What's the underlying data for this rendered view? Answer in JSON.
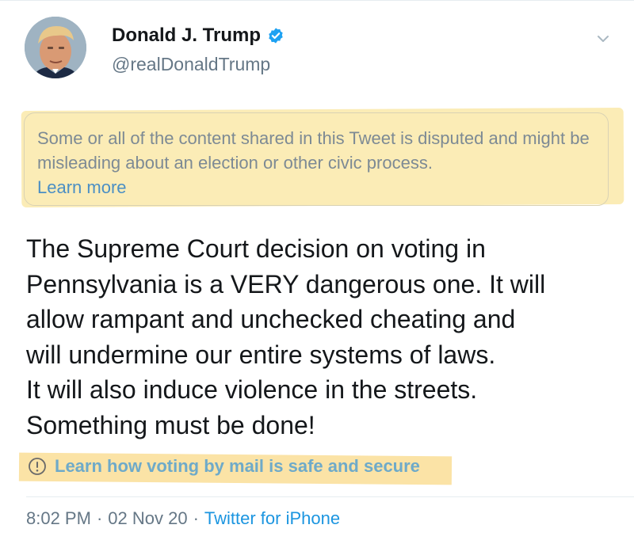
{
  "author": {
    "display_name": "Donald J. Trump",
    "handle": "@realDonaldTrump",
    "verified": true,
    "avatar_icon": "profile-photo"
  },
  "notice": {
    "text": "Some or all of the content shared in this Tweet is disputed and might be misleading about an election or other civic process.",
    "link_label": "Learn more"
  },
  "tweet": {
    "lines": [
      "The Supreme Court decision on voting in",
      "Pennsylvania is a VERY dangerous one. It will",
      "allow rampant and unchecked cheating and",
      "will undermine our entire systems of laws.",
      "It will also induce violence in the streets.",
      "Something must be done!"
    ]
  },
  "voting_link": {
    "icon": "info-circle-icon",
    "label": "Learn how voting by mail is safe and secure"
  },
  "footer": {
    "time": "8:02 PM",
    "separator": "·",
    "date": "02 Nov 20",
    "source": "Twitter for iPhone"
  },
  "colors": {
    "verified_blue": "#1da1f2",
    "link_blue": "#1b95e0",
    "highlighter": "#fbe3a6",
    "muted": "#657786"
  }
}
